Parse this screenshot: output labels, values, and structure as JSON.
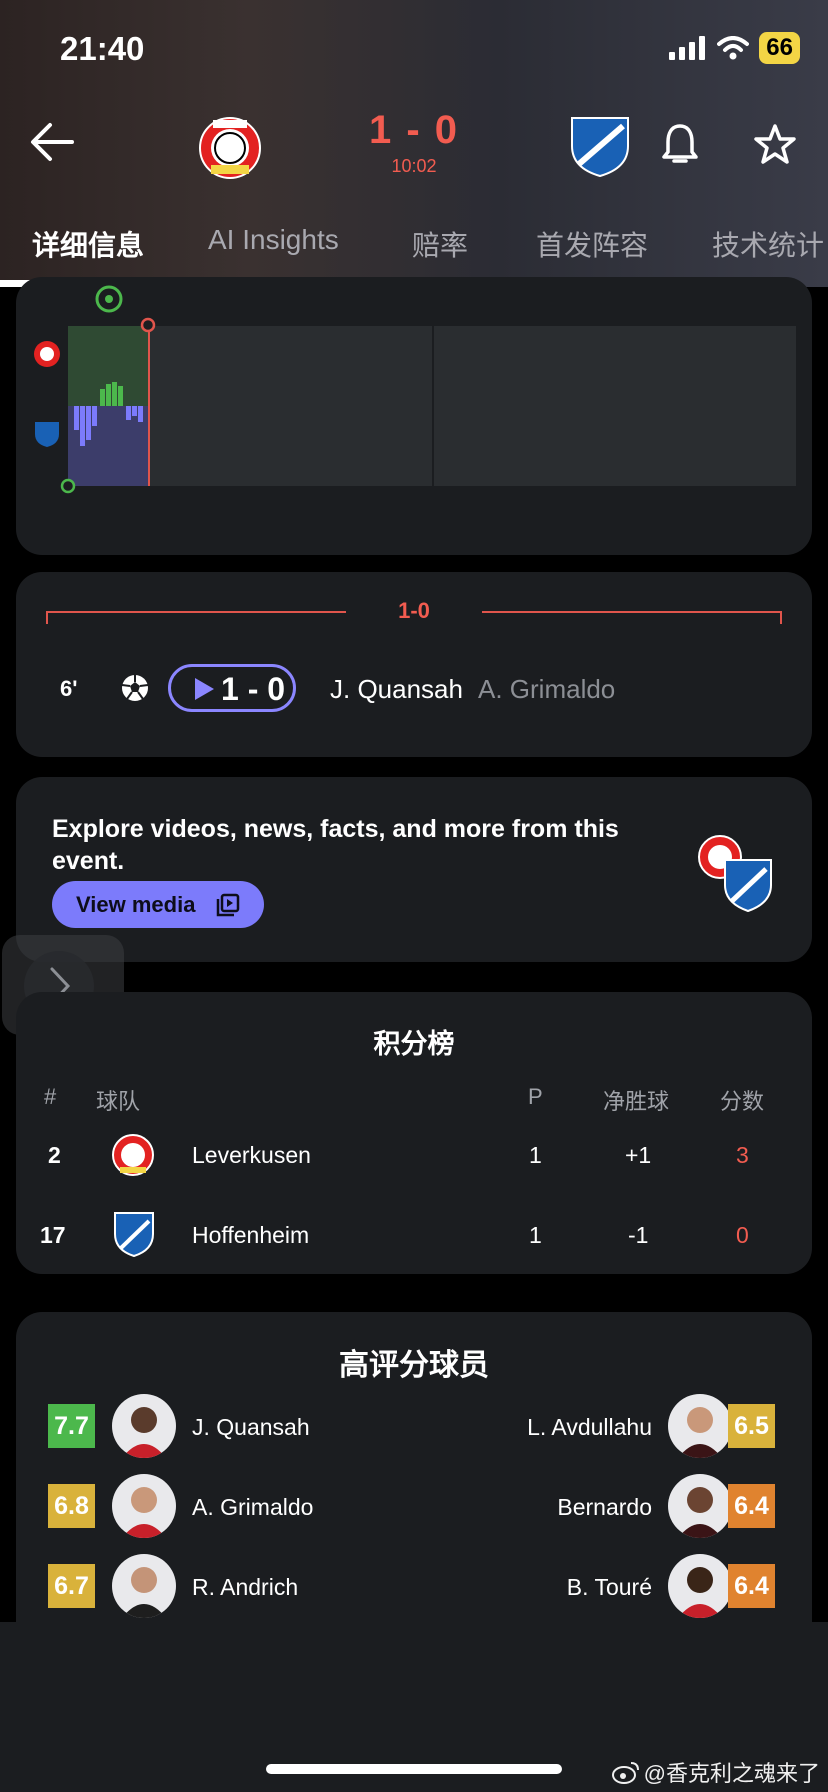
{
  "status": {
    "time": "21:40",
    "battery": "66"
  },
  "match": {
    "score": "1 - 0",
    "clock": "10:02"
  },
  "tabs": [
    "详细信息",
    "AI Insights",
    "赔率",
    "首发阵容",
    "技术统计"
  ],
  "goals": {
    "divider_score": "1-0",
    "events": [
      {
        "minute": "6'",
        "score": "1 - 0",
        "scorer": "J. Quansah",
        "assist": "A. Grimaldo"
      }
    ]
  },
  "media": {
    "text": "Explore videos, news, facts, and more from this event.",
    "button": "View media"
  },
  "standings": {
    "title": "积分榜",
    "headers": [
      "#",
      "球队",
      "P",
      "净胜球",
      "分数"
    ],
    "rows": [
      {
        "rank": "2",
        "team": "Leverkusen",
        "p": "1",
        "gd": "+1",
        "pts": "3"
      },
      {
        "rank": "17",
        "team": "Hoffenheim",
        "p": "1",
        "gd": "-1",
        "pts": "0"
      }
    ]
  },
  "top_rated": {
    "title": "高评分球员",
    "home": [
      {
        "rating": "7.7",
        "name": "J. Quansah",
        "color": "#4cb84c"
      },
      {
        "rating": "6.8",
        "name": "A. Grimaldo",
        "color": "#d9b23b"
      },
      {
        "rating": "6.7",
        "name": "R. Andrich",
        "color": "#d9b23b"
      }
    ],
    "away": [
      {
        "rating": "6.5",
        "name": "L. Avdullahu",
        "color": "#d9b23b"
      },
      {
        "rating": "6.4",
        "name": "Bernardo",
        "color": "#e0832f"
      },
      {
        "rating": "6.4",
        "name": "B. Touré",
        "color": "#e0832f"
      }
    ]
  },
  "watermark": "@香克利之魂来了",
  "colors": {
    "accent": "#f25c50",
    "media_button": "#7c7bfb",
    "card": "#1b1d20"
  }
}
